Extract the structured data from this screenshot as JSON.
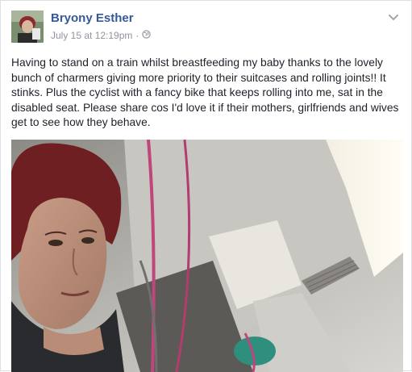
{
  "post": {
    "author": "Bryony Esther",
    "date": "July 15 at 12:19pm",
    "separator": "·",
    "privacy_icon": "globe-icon",
    "options_icon": "chevron-down-icon",
    "text": "Having to stand on a train whilst breastfeeding my baby thanks to the lovely bunch of charmers giving more priority to their suitcases and rolling joints!! It stinks. Plus the cyclist with a fancy bike that keeps rolling into me, sat in the disabled seat. Please share cos I'd love it if their mothers, girlfriends and wives get to see how they behave."
  },
  "colors": {
    "author_link": "#365899",
    "meta_text": "#90949c",
    "body_text": "#1d2129",
    "grab_rail": "#c0457a"
  }
}
